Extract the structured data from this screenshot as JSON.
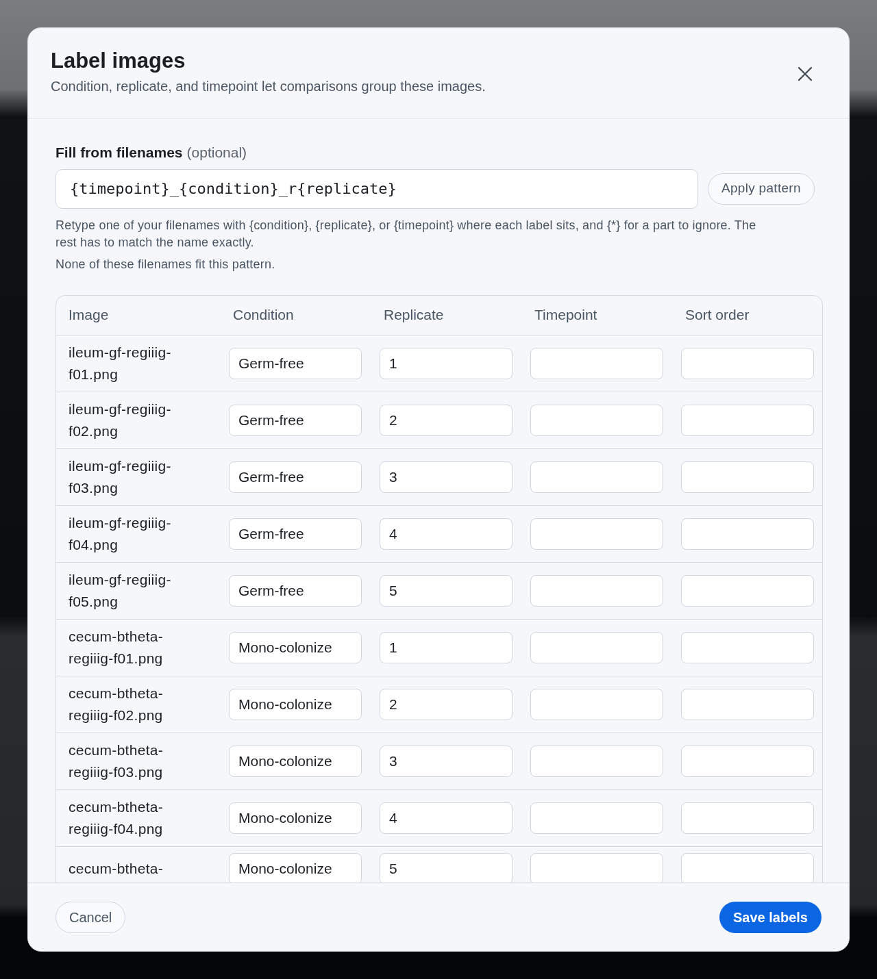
{
  "dialog": {
    "title": "Label images",
    "subtitle": "Condition, replicate, and timepoint let comparisons group these images."
  },
  "pattern": {
    "label": "Fill from filenames",
    "label_note": "(optional)",
    "value": "{timepoint}_{condition}_r{replicate}",
    "apply_button": "Apply pattern",
    "help": "Retype one of your filenames with {condition}, {replicate}, or {timepoint} where each label sits, and {*} for a part to ignore. The rest has to match the name exactly.",
    "status": "None of these filenames fit this pattern."
  },
  "table": {
    "columns": [
      "Image",
      "Condition",
      "Replicate",
      "Timepoint",
      "Sort order"
    ],
    "rows": [
      {
        "image": "ileum-gf-regiiig-f01.png",
        "condition": "Germ-free",
        "replicate": "1"
      },
      {
        "image": "ileum-gf-regiiig-f02.png",
        "condition": "Germ-free",
        "replicate": "2"
      },
      {
        "image": "ileum-gf-regiiig-f03.png",
        "condition": "Germ-free",
        "replicate": "3"
      },
      {
        "image": "ileum-gf-regiiig-f04.png",
        "condition": "Germ-free",
        "replicate": "4"
      },
      {
        "image": "ileum-gf-regiiig-f05.png",
        "condition": "Germ-free",
        "replicate": "5"
      },
      {
        "image": "cecum-btheta-regiiig-f01.png",
        "condition": "Mono-colonize",
        "replicate": "1"
      },
      {
        "image": "cecum-btheta-regiiig-f02.png",
        "condition": "Mono-colonize",
        "replicate": "2"
      },
      {
        "image": "cecum-btheta-regiiig-f03.png",
        "condition": "Mono-colonize",
        "replicate": "3"
      },
      {
        "image": "cecum-btheta-regiiig-f04.png",
        "condition": "Mono-colonize",
        "replicate": "4"
      },
      {
        "image": "cecum-btheta-",
        "condition": "Mono-colonize",
        "replicate": "5"
      }
    ]
  },
  "footer": {
    "cancel": "Cancel",
    "save": "Save labels"
  }
}
